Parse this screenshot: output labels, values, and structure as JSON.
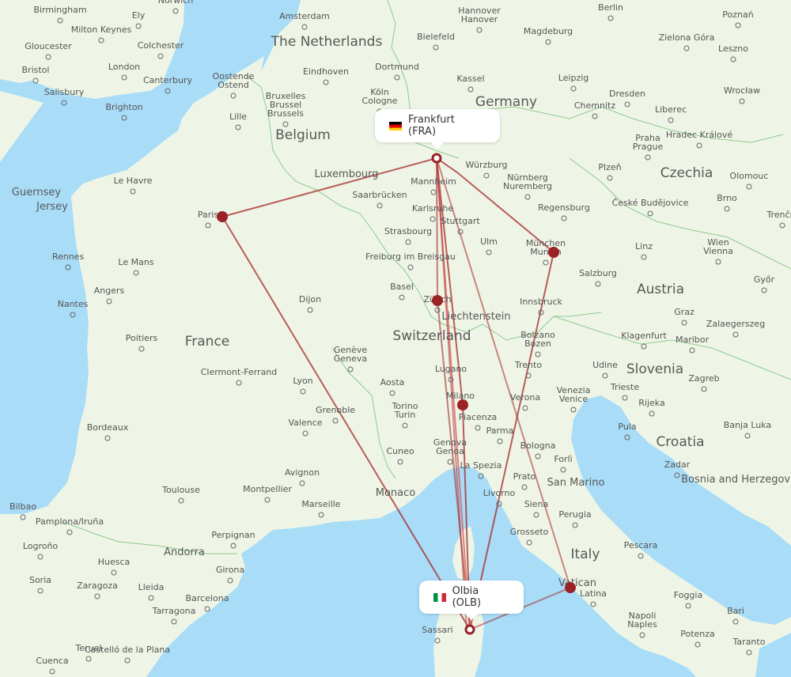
{
  "map": {
    "colors": {
      "land": "#eef5e6",
      "water": "#a8dcf7",
      "route": "#a52a2a",
      "marker": "#9b2226",
      "border": "#8fc98f"
    },
    "origin": {
      "name": "Frankfurt",
      "code": "FRA",
      "label": "Frankfurt (FRA)",
      "flag": "germany"
    },
    "destination": {
      "name": "Olbia",
      "code": "OLB",
      "label": "Olbia (OLB)",
      "flag": "italy"
    },
    "stopovers": [
      "Paris",
      "Zürich",
      "Milano",
      "München",
      "Vatican / Rome"
    ],
    "country_labels": [
      "The Netherlands",
      "Belgium",
      "Luxembourg",
      "Germany",
      "Czechia",
      "Austria",
      "Switzerland",
      "Liechtenstein",
      "France",
      "Slovenia",
      "Croatia",
      "Bosnia and Herzegovina",
      "San Marino",
      "Monaco",
      "Andorra",
      "Italy",
      "Vatican",
      "Guernsey",
      "Jersey"
    ],
    "city_labels": [
      "Birmingham",
      "Norwich",
      "Ely",
      "Milton Keynes",
      "Gloucester",
      "Colchester",
      "London",
      "Bristol",
      "Canterbury",
      "Salisbury",
      "Brighton",
      "Oostende - Ostend",
      "Lille",
      "Bruxelles - Brussel - Brussels",
      "Amsterdam",
      "Eindhoven",
      "Dortmund",
      "Köln - Cologne",
      "Bielefeld",
      "Hannover - Hanover",
      "Kassel",
      "Magdeburg",
      "Berlin",
      "Leipzig",
      "Dresden",
      "Chemnitz",
      "Poznań",
      "Zielona Góra",
      "Leszno",
      "Wrocław",
      "Liberec",
      "Praha - Prague",
      "Hradec Králové",
      "Plzeň",
      "Olomouc",
      "České Budějovice",
      "Brno",
      "Trenčín",
      "Wien - Vienna",
      "Linz",
      "Salzburg",
      "Győr",
      "Graz",
      "Zalaegerszeg",
      "Klagenfurt",
      "Maribor",
      "Udine",
      "Trieste",
      "Venezia - Venice",
      "Rijeka",
      "Zagreb",
      "Pula",
      "Zadar",
      "Banja Luka",
      "Würzburg",
      "Nürnberg - Nuremberg",
      "Regensburg",
      "Mannheim",
      "Saarbrücken",
      "Karlsruhe",
      "Stuttgart",
      "Strasbourg",
      "Ulm",
      "München - Munich",
      "Freiburg im Breisgau",
      "Basel",
      "Zürich",
      "Innsbruck",
      "Bolzano - Bozen",
      "Trento",
      "Verona",
      "Lugano",
      "Milano",
      "Piacenza",
      "Parma",
      "Bologna",
      "Forlì",
      "Genève - Geneva",
      "Aosta",
      "Torino - Turin",
      "Genova - Genoa",
      "La Spezia",
      "Cuneo",
      "Prato",
      "Livorno",
      "Siena",
      "Perugia",
      "Grosseto",
      "Pescara",
      "Latina",
      "Napoli - Naples",
      "Foggia",
      "Bari",
      "Potenza",
      "Taranto",
      "Le Havre",
      "Paris",
      "Rennes",
      "Le Mans",
      "Angers",
      "Nantes",
      "Poitiers",
      "Dijon",
      "Clermont-Ferrand",
      "Lyon",
      "Grenoble",
      "Valence",
      "Avignon",
      "Montpellier",
      "Marseille",
      "Bordeaux",
      "Toulouse",
      "Perpignan",
      "Bilbao",
      "Pamplona/Iruña",
      "Logroño",
      "Huesca",
      "Zaragoza",
      "Lleida",
      "Girona",
      "Barcelona",
      "Tarragona",
      "Soria",
      "Teruel",
      "Castelló de la Plana",
      "Cuenca",
      "Sassari"
    ]
  }
}
